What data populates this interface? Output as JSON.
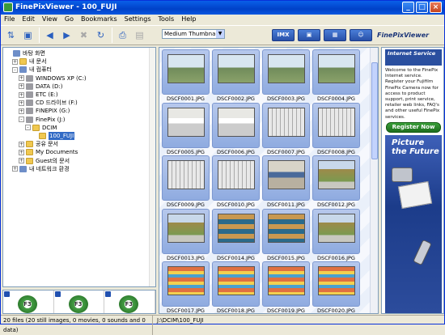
{
  "window": {
    "title": "FinePixViewer - 100_FUJI"
  },
  "menu": [
    "File",
    "Edit",
    "View",
    "Go",
    "Bookmarks",
    "Settings",
    "Tools",
    "Help"
  ],
  "toolbar": {
    "view_select": "Medium Thumbnail",
    "mode_buttons": [
      "IMX",
      "",
      "",
      ""
    ],
    "logo": "FinePixViewer"
  },
  "tree": [
    {
      "label": "바탕 화면",
      "depth": 0,
      "icon": "desktop-icon"
    },
    {
      "label": "내 문서",
      "depth": 1,
      "icon": "folder-icon",
      "expander": "+"
    },
    {
      "label": "내 컴퓨터",
      "depth": 1,
      "icon": "computer-icon",
      "expander": "-"
    },
    {
      "label": "WINDOWS XP (C:)",
      "depth": 2,
      "icon": "drive-icon",
      "expander": "+"
    },
    {
      "label": "DATA (D:)",
      "depth": 2,
      "icon": "drive-icon",
      "expander": "+"
    },
    {
      "label": "ETC (E:)",
      "depth": 2,
      "icon": "drive-icon",
      "expander": "+"
    },
    {
      "label": "CD 드라이브 (F:)",
      "depth": 2,
      "icon": "cd-drive-icon",
      "expander": "+"
    },
    {
      "label": "FINEPIX (G:)",
      "depth": 2,
      "icon": "drive-icon",
      "expander": "+"
    },
    {
      "label": "FinePix (J:)",
      "depth": 2,
      "icon": "drive-icon",
      "expander": "-"
    },
    {
      "label": "DCIM",
      "depth": 3,
      "icon": "folder-icon",
      "expander": "-"
    },
    {
      "label": "100_FUJI",
      "depth": 4,
      "icon": "folder-icon",
      "selected": true
    },
    {
      "label": "공유 문서",
      "depth": 2,
      "icon": "folder-icon",
      "expander": "+"
    },
    {
      "label": "My Documents",
      "depth": 2,
      "icon": "folder-icon",
      "expander": "+"
    },
    {
      "label": "Guest의 문서",
      "depth": 2,
      "icon": "folder-icon",
      "expander": "+"
    },
    {
      "label": "내 네트워크 환경",
      "depth": 1,
      "icon": "network-icon",
      "expander": "+"
    }
  ],
  "thumbnails": [
    {
      "name": "DSCF0001.JPG",
      "style": "outdoor"
    },
    {
      "name": "DSCF0002.JPG",
      "style": "outdoor"
    },
    {
      "name": "DSCF0003.JPG",
      "style": "outdoor"
    },
    {
      "name": "DSCF0004.JPG",
      "style": "outdoor"
    },
    {
      "name": "DSCF0005.JPG",
      "style": "box"
    },
    {
      "name": "DSCF0006.JPG",
      "style": "box"
    },
    {
      "name": "DSCF0007.JPG",
      "style": "rack"
    },
    {
      "name": "DSCF0008.JPG",
      "style": "rack"
    },
    {
      "name": "DSCF0009.JPG",
      "style": "rack"
    },
    {
      "name": "DSCF0010.JPG",
      "style": "rack"
    },
    {
      "name": "DSCF0011.JPG",
      "style": "desk"
    },
    {
      "name": "DSCF0012.JPG",
      "style": "tree"
    },
    {
      "name": "DSCF0013.JPG",
      "style": "tree"
    },
    {
      "name": "DSCF0014.JPG",
      "style": "store"
    },
    {
      "name": "DSCF0015.JPG",
      "style": "store"
    },
    {
      "name": "DSCF0016.JPG",
      "style": "tree"
    },
    {
      "name": "DSCF0017.JPG",
      "style": "shelf"
    },
    {
      "name": "DSCF0018.JPG",
      "style": "shelf"
    },
    {
      "name": "DSCF0019.JPG",
      "style": "shelf"
    },
    {
      "name": "DSCF0020.JPG",
      "style": "shelf"
    }
  ],
  "promo": {
    "banner": "Internet Service",
    "text": "Welcome to the FinePix Internet service. Register your Fujifilm FinePix Camera now for access to product support, print service, retailer web links, FAQ's and other useful FinePix services.",
    "register": "Register Now",
    "future": "Picture the Future"
  },
  "bottom_panes": [
    "F3",
    "F3",
    "F3"
  ],
  "status": {
    "left": "20 files (20 still images, 0 movies, 0 sounds and 0 data)",
    "right": "J:\\DCIM\\100_FUJI"
  }
}
